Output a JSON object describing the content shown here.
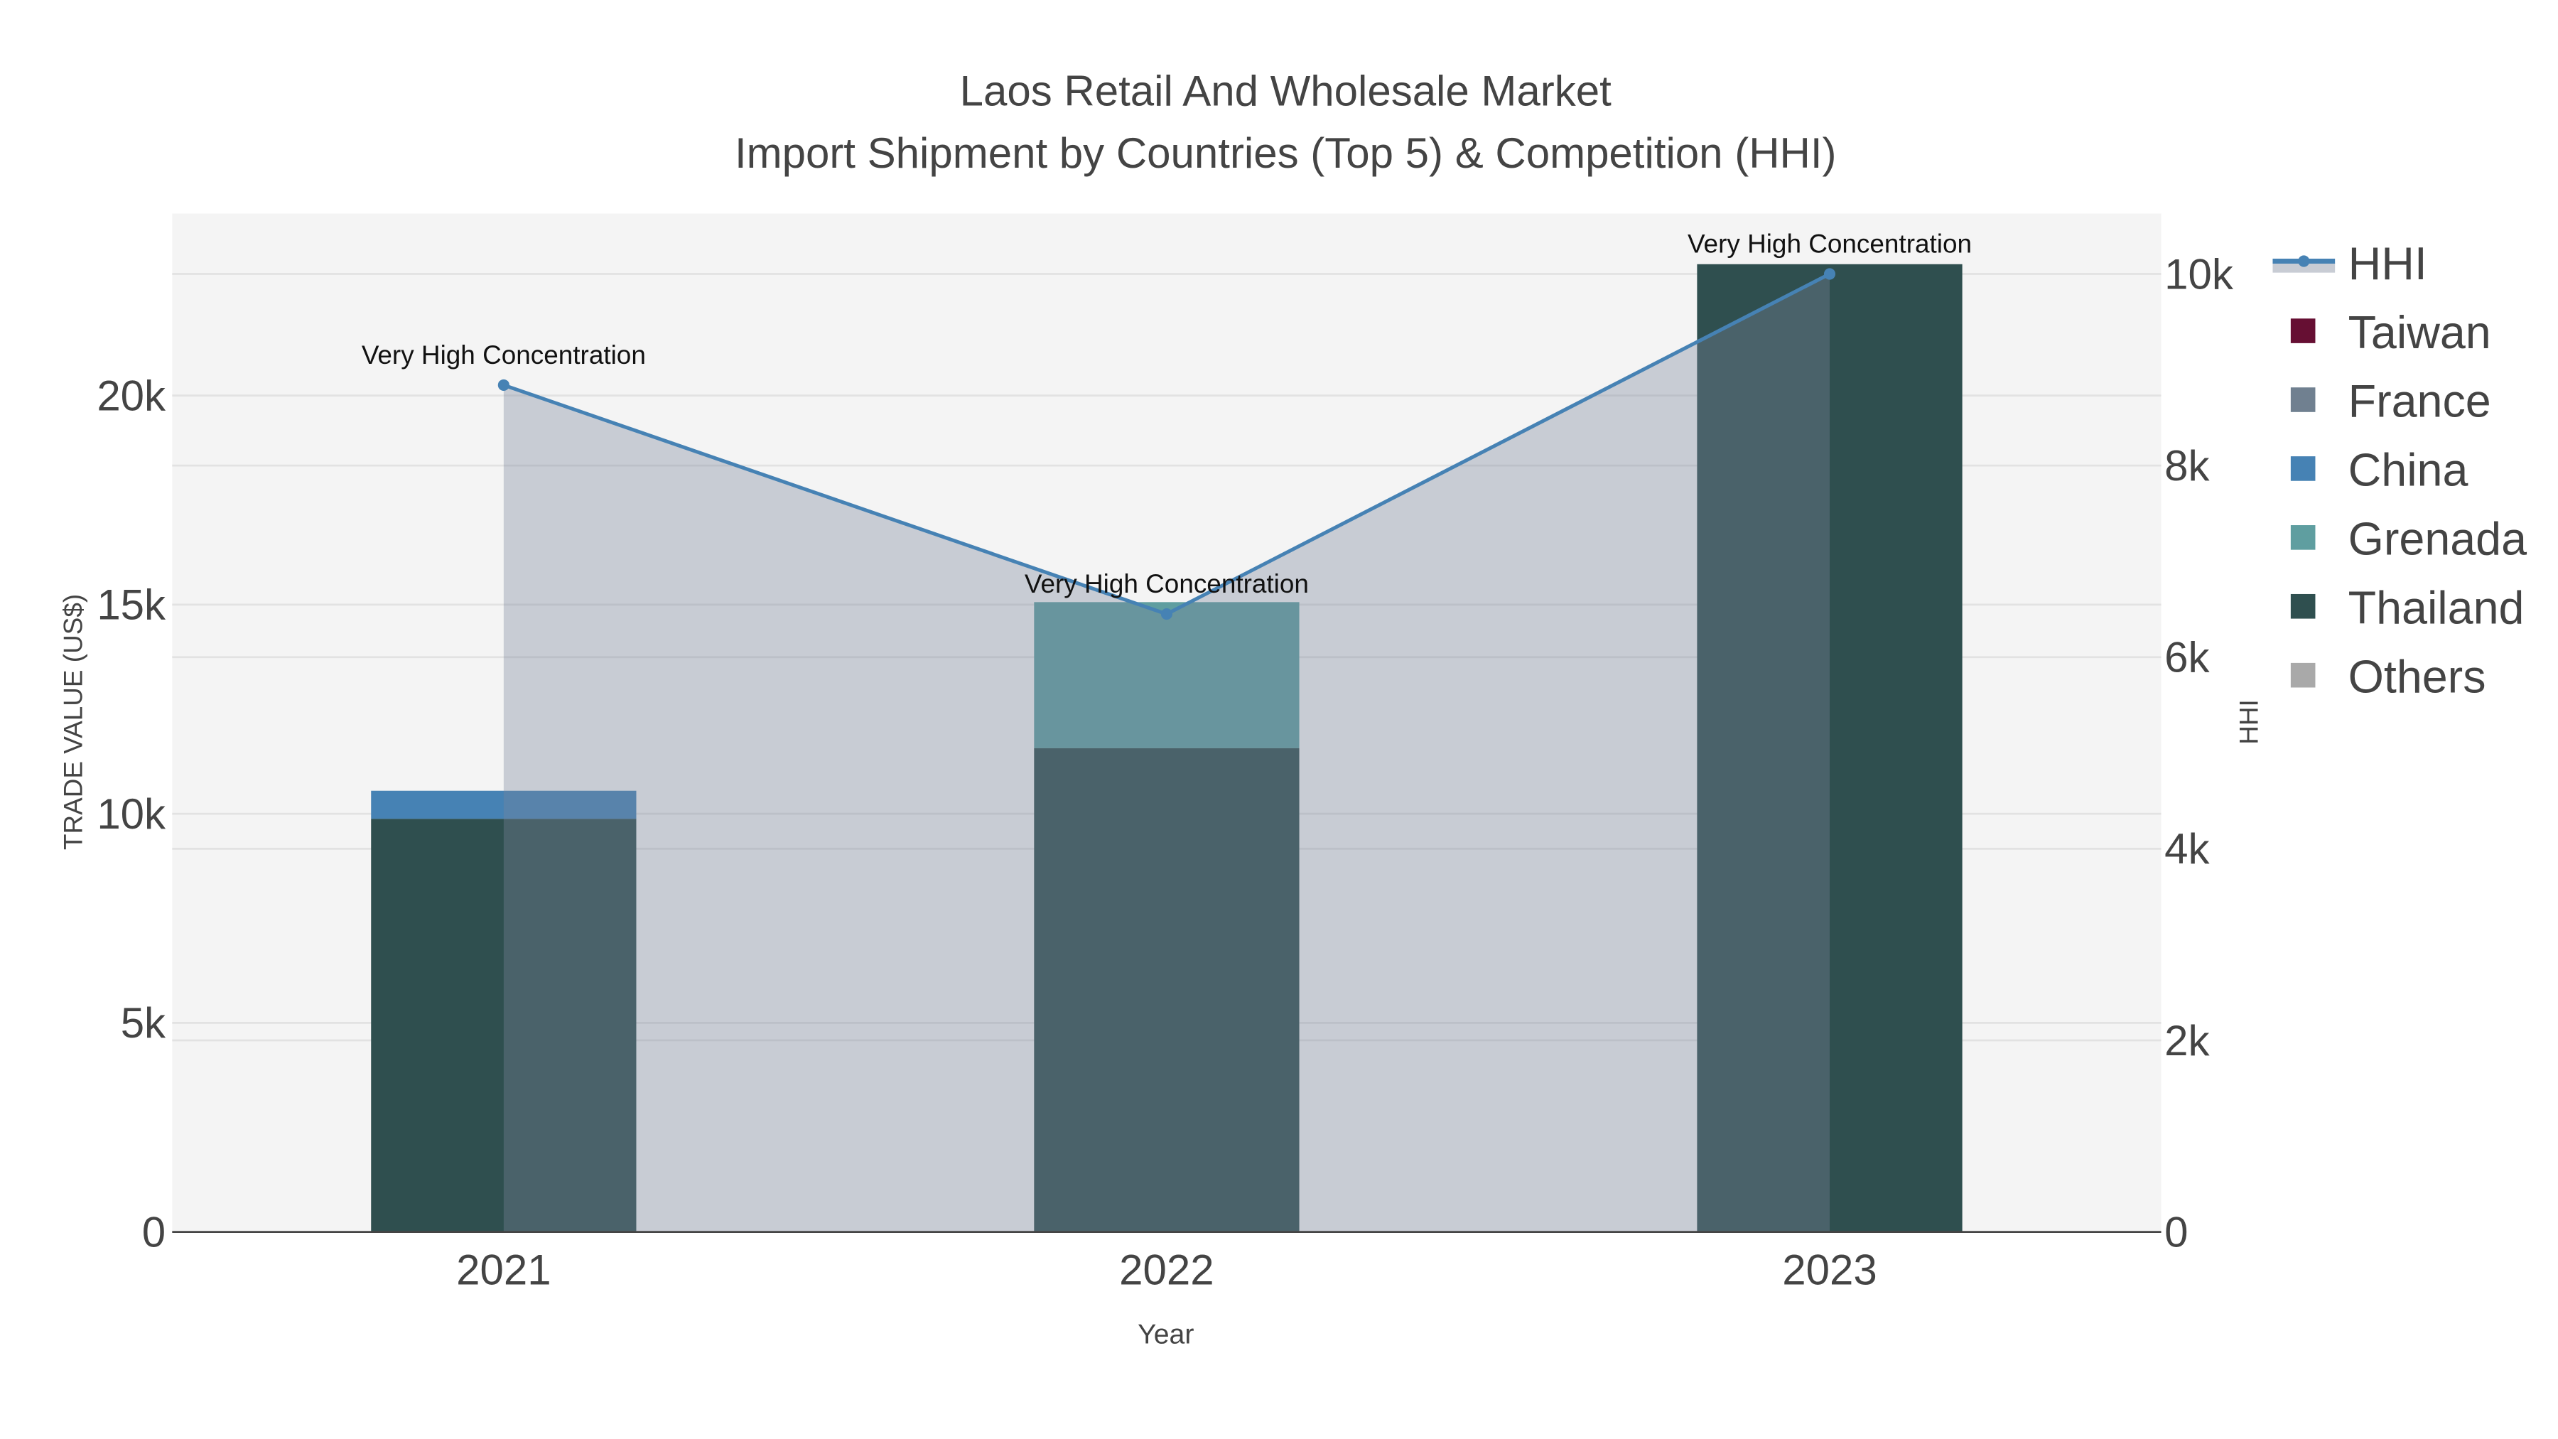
{
  "chart_data": {
    "type": "bar",
    "title_line1": "Laos Retail And Wholesale Market",
    "title_line2": "Import Shipment by Countries (Top 5) & Competition (HHI)",
    "xlabel": "Year",
    "ylabel": "TRADE VALUE (US$)",
    "y2label": "HHI",
    "categories": [
      "2021",
      "2022",
      "2023"
    ],
    "ylim": [
      0,
      24350
    ],
    "y2lim": [
      0,
      10630
    ],
    "yticks": [
      {
        "v": 0,
        "label": "0"
      },
      {
        "v": 5000,
        "label": "5k"
      },
      {
        "v": 10000,
        "label": "10k"
      },
      {
        "v": 15000,
        "label": "15k"
      },
      {
        "v": 20000,
        "label": "20k"
      }
    ],
    "y2ticks": [
      {
        "v": 0,
        "label": "0"
      },
      {
        "v": 2000,
        "label": "2k"
      },
      {
        "v": 4000,
        "label": "4k"
      },
      {
        "v": 6000,
        "label": "6k"
      },
      {
        "v": 8000,
        "label": "8k"
      },
      {
        "v": 10000,
        "label": "10k"
      }
    ],
    "barmode": "stack",
    "series": [
      {
        "name": "Thailand",
        "color": "#2f4f4f",
        "values": [
          9880,
          11570,
          23140
        ]
      },
      {
        "name": "China",
        "color": "#4682b4",
        "values": [
          670,
          0,
          0
        ]
      },
      {
        "name": "Grenada",
        "color": "#5f9ea0",
        "values": [
          0,
          3490,
          0
        ]
      },
      {
        "name": "Taiwan",
        "color": "#660f33",
        "values": [
          0,
          0,
          0
        ]
      },
      {
        "name": "France",
        "color": "#708090",
        "values": [
          0,
          0,
          0
        ]
      },
      {
        "name": "Others",
        "color": "#a9a9a9",
        "values": [
          0,
          0,
          0
        ]
      }
    ],
    "hhi": {
      "name": "HHI",
      "color": "#4682b4",
      "fill": "rgba(122,133,155,0.36)",
      "values": [
        8840,
        6450,
        10000
      ]
    },
    "annotations": [
      "Very High Concentration",
      "Very High Concentration",
      "Very High Concentration"
    ],
    "legend": [
      "HHI",
      "Taiwan",
      "France",
      "China",
      "Grenada",
      "Thailand",
      "Others"
    ],
    "legend_placement": "right"
  }
}
